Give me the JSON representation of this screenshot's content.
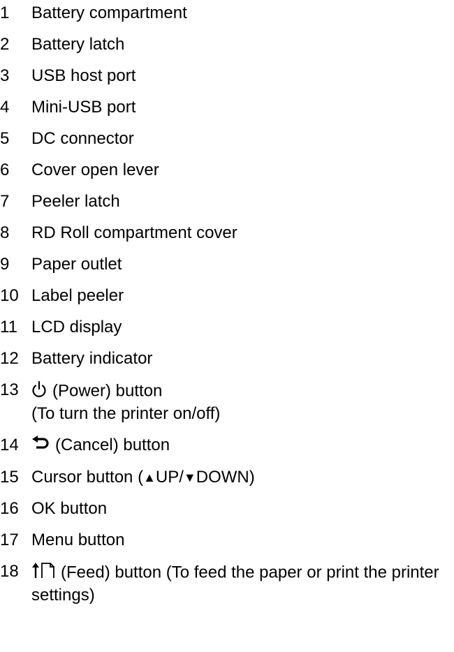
{
  "items": [
    {
      "num": "1",
      "label": "Battery compartment"
    },
    {
      "num": "2",
      "label": "Battery latch"
    },
    {
      "num": "3",
      "label": "USB host port"
    },
    {
      "num": "4",
      "label": "Mini-USB port"
    },
    {
      "num": "5",
      "label": "DC connector"
    },
    {
      "num": "6",
      "label": "Cover open lever"
    },
    {
      "num": "7",
      "label": "Peeler latch"
    },
    {
      "num": "8",
      "label": "RD Roll compartment cover"
    },
    {
      "num": "9",
      "label": "Paper outlet"
    },
    {
      "num": "10",
      "label": "Label peeler"
    },
    {
      "num": "11",
      "label": "LCD display"
    },
    {
      "num": "12",
      "label": "Battery indicator"
    },
    {
      "num": "13",
      "icon": "power-icon",
      "label": "(Power) button",
      "label2": "(To turn the printer on/off)"
    },
    {
      "num": "14",
      "icon": "cancel-arrow-icon",
      "label": "(Cancel) button"
    },
    {
      "num": "15",
      "label_pre": "Cursor button (",
      "up_label": "UP/",
      "down_label": "DOWN)"
    },
    {
      "num": "16",
      "label": "OK button"
    },
    {
      "num": "17",
      "label": "Menu button"
    },
    {
      "num": "18",
      "icon": "feed-icon",
      "label": "(Feed) button (To feed the paper or print the printer settings)"
    }
  ]
}
